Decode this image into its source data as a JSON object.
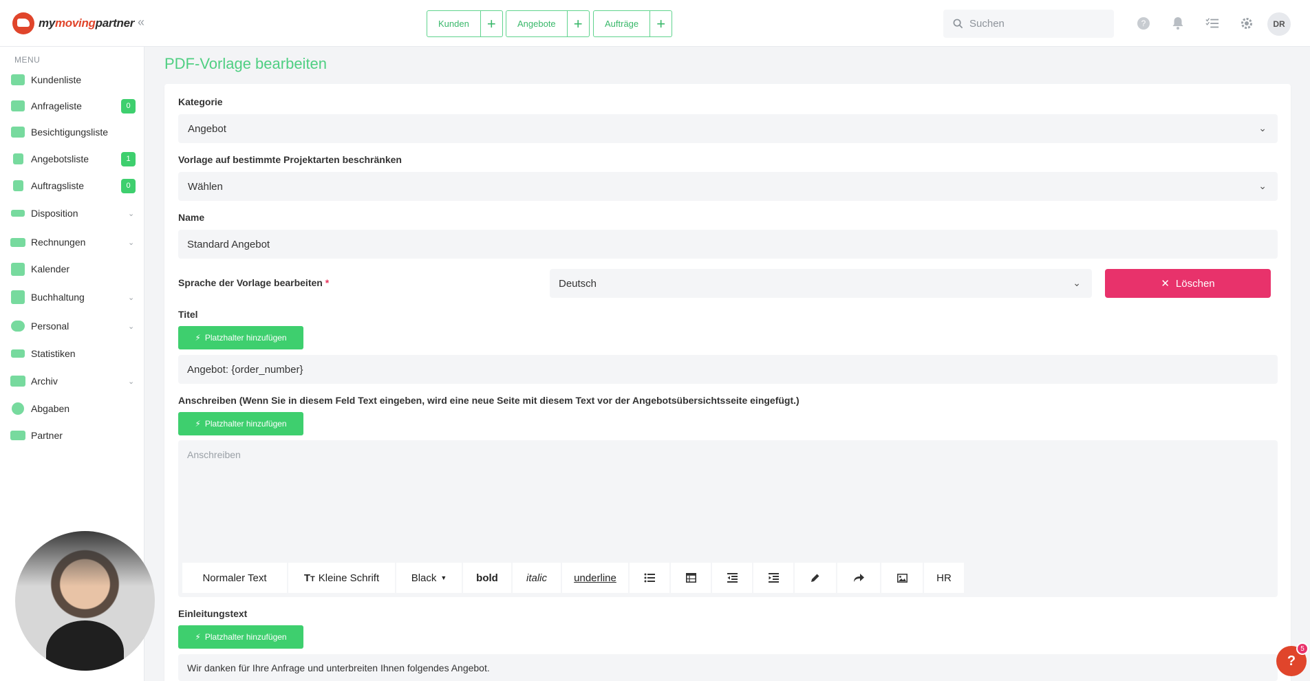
{
  "header": {
    "logo_prefix": "my",
    "logo_brand": "moving",
    "logo_suffix": "partner",
    "quick_actions": [
      {
        "label": "Kunden"
      },
      {
        "label": "Angebote"
      },
      {
        "label": "Aufträge"
      }
    ],
    "search_placeholder": "Suchen",
    "avatar_initials": "DR"
  },
  "sidebar": {
    "heading": "MENU",
    "items": [
      {
        "label": "Kundenliste"
      },
      {
        "label": "Anfrageliste",
        "badge": "0"
      },
      {
        "label": "Besichtigungsliste"
      },
      {
        "label": "Angebotsliste",
        "badge": "1"
      },
      {
        "label": "Auftragsliste",
        "badge": "0"
      },
      {
        "label": "Disposition",
        "expandable": true
      },
      {
        "label": "Rechnungen",
        "expandable": true
      },
      {
        "label": "Kalender"
      },
      {
        "label": "Buchhaltung",
        "expandable": true
      },
      {
        "label": "Personal",
        "expandable": true
      },
      {
        "label": "Statistiken"
      },
      {
        "label": "Archiv",
        "expandable": true
      },
      {
        "label": "Abgaben"
      },
      {
        "label": "Partner"
      }
    ]
  },
  "main": {
    "page_title": "PDF-Vorlage bearbeiten",
    "kategorie": {
      "label": "Kategorie",
      "value": "Angebot"
    },
    "projektarten": {
      "label": "Vorlage auf bestimmte Projektarten beschränken",
      "value": "Wählen"
    },
    "name": {
      "label": "Name",
      "value": "Standard Angebot"
    },
    "sprache": {
      "label": "Sprache der Vorlage bearbeiten",
      "required_mark": "*",
      "value": "Deutsch"
    },
    "delete_label": "Löschen",
    "placeholder_button": "Platzhalter hinzufügen",
    "titel": {
      "label": "Titel",
      "value": "Angebot: {order_number}"
    },
    "anschreiben": {
      "label": "Anschreiben (Wenn Sie in diesem Feld Text eingeben, wird eine neue Seite mit diesem Text vor der Angebotsübersichtsseite eingefügt.)",
      "placeholder": "Anschreiben"
    },
    "toolbar": {
      "normal_text": "Normaler Text",
      "small_font": "Kleine Schrift",
      "color": "Black",
      "bold": "bold",
      "italic": "italic",
      "underline": "underline",
      "hr": "HR"
    },
    "einleitung": {
      "label": "Einleitungstext",
      "value": "Wir danken für Ihre Anfrage und unterbreiten Ihnen folgendes Angebot."
    }
  },
  "help_widget": {
    "badge": "5",
    "label": "?"
  }
}
